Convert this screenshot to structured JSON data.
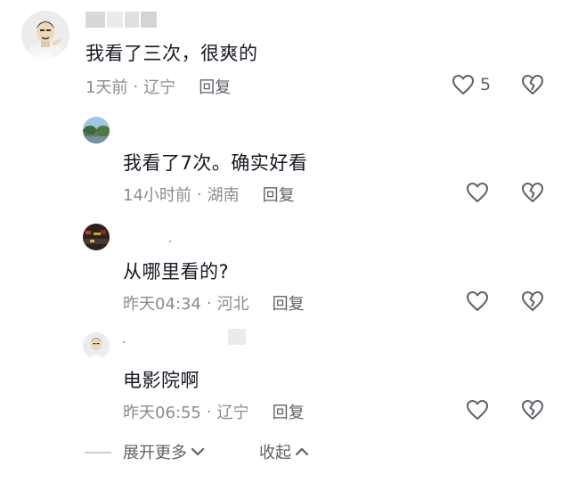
{
  "comments": [
    {
      "text": "我看了三次，很爽的",
      "time": "1天前",
      "location": "辽宁",
      "reply_label": "回复",
      "like_count": "5",
      "like_icon": "heart-outline-icon",
      "dislike_icon": "broken-heart-icon"
    },
    {
      "text": "我看了7次。确实好看",
      "time": "14小时前",
      "location": "湖南",
      "reply_label": "回复",
      "like_count": "",
      "like_icon": "heart-outline-icon",
      "dislike_icon": "broken-heart-icon"
    },
    {
      "text": "从哪里看的?",
      "time": "昨天04:34",
      "location": "河北",
      "reply_label": "回复",
      "like_count": "",
      "like_icon": "heart-outline-icon",
      "dislike_icon": "broken-heart-icon"
    },
    {
      "text": "电影院啊",
      "time": "昨天06:55",
      "location": "辽宁",
      "reply_label": "回复",
      "like_count": "",
      "like_icon": "heart-outline-icon",
      "dislike_icon": "broken-heart-icon"
    }
  ],
  "footer": {
    "expand_label": "展开更多",
    "collapse_label": "收起",
    "expand_icon": "chevron-down-icon",
    "collapse_icon": "chevron-up-icon"
  },
  "colors": {
    "text": "#161823",
    "meta": "#8a8b91",
    "icon": "#5f6068"
  }
}
